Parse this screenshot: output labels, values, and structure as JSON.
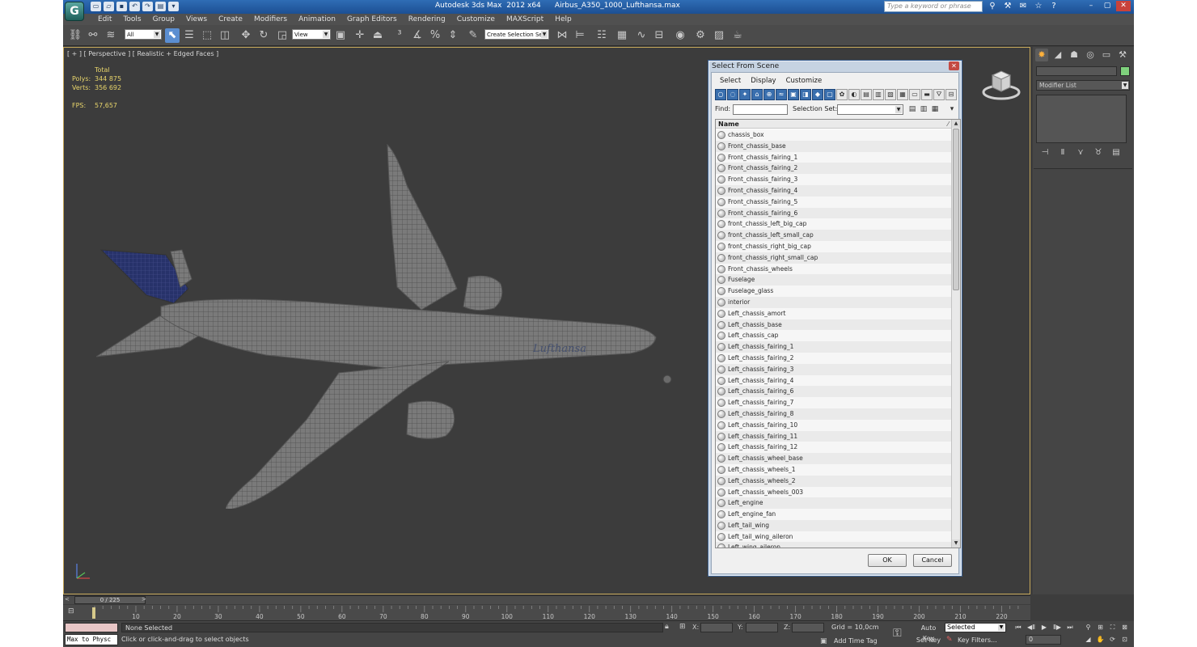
{
  "window": {
    "title": "Autodesk 3ds Max  2012 x64      Airbus_A350_1000_Lufthansa.max",
    "logo": "3ds-max-logo",
    "help_placeholder": "Type a keyword or phrase"
  },
  "menu": [
    "Edit",
    "Tools",
    "Group",
    "Views",
    "Create",
    "Modifiers",
    "Animation",
    "Graph Editors",
    "Rendering",
    "Customize",
    "MAXScript",
    "Help"
  ],
  "toolbar": {
    "selection_filter": "All",
    "ref_coord": "View",
    "named_selection": "Create Selection Se"
  },
  "viewport": {
    "label": "[ + ] [ Perspective ] [ Realistic + Edged Faces ]",
    "stats": {
      "header": "Total",
      "polys_label": "Polys:",
      "polys": "344 875",
      "verts_label": "Verts:",
      "verts": "356 692",
      "fps_label": "FPS:",
      "fps": "57,657"
    },
    "livery_text": "Lufthansa"
  },
  "dialog": {
    "title": "Select From Scene",
    "menu": [
      "Select",
      "Display",
      "Customize"
    ],
    "find_label": "Find:",
    "find_value": "",
    "selection_set_label": "Selection Set:",
    "column_header": "Name",
    "items": [
      "chassis_box",
      "Front_chassis_base",
      "Front_chassis_fairing_1",
      "Front_chassis_fairing_2",
      "Front_chassis_fairing_3",
      "Front_chassis_fairing_4",
      "Front_chassis_fairing_5",
      "Front_chassis_fairing_6",
      "front_chassis_left_big_cap",
      "front_chassis_left_small_cap",
      "front_chassis_right_big_cap",
      "front_chassis_right_small_cap",
      "Front_chassis_wheels",
      "Fuselage",
      "Fuselage_glass",
      "interior",
      "Left_chassis_amort",
      "Left_chassis_base",
      "Left_chassis_cap",
      "Left_chassis_fairing_1",
      "Left_chassis_fairing_2",
      "Left_chassis_fairing_3",
      "Left_chassis_fairing_4",
      "Left_chassis_fairing_6",
      "Left_chassis_fairing_7",
      "Left_chassis_fairing_8",
      "Left_chassis_fairing_10",
      "Left_chassis_fairing_11",
      "Left_chassis_fairing_12",
      "Left_chassis_wheel_base",
      "Left_chassis_wheels_1",
      "Left_chassis_wheels_2",
      "Left_chassis_wheels_003",
      "Left_engine",
      "Left_engine_fan",
      "Left_tail_wing",
      "Left_tail_wing_aileron",
      "Left_wing_aileron"
    ],
    "ok_label": "OK",
    "cancel_label": "Cancel"
  },
  "command_panel": {
    "modifier_list": "Modifier List",
    "object_color": "#7fd17d"
  },
  "time_slider": {
    "frame": "0 / 225",
    "prev": "<",
    "next": ">"
  },
  "trackbar": {
    "ticks": [
      "10",
      "20",
      "30",
      "40",
      "50",
      "60",
      "70",
      "80",
      "90",
      "100",
      "110",
      "120",
      "130",
      "140",
      "150",
      "160",
      "170",
      "180",
      "190",
      "200",
      "210",
      "220"
    ]
  },
  "status": {
    "maxscript": "Max to Physc",
    "selection": "None Selected",
    "prompt": "Click or click-and-drag to select objects",
    "x_label": "X:",
    "y_label": "Y:",
    "z_label": "Z:",
    "grid": "Grid = 10,0cm",
    "add_time_tag": "Add Time Tag",
    "auto_key": "Auto Key",
    "set_key": "Set Key",
    "key_mode": "Selected",
    "key_filters": "Key Filters...",
    "frame_value": "0"
  },
  "colors": {
    "viewport_border": "#c6a85a",
    "stats_text": "#e8d56b",
    "titlebar": "#2f6db5",
    "dialog_selected_tool": "#3a6fae"
  }
}
